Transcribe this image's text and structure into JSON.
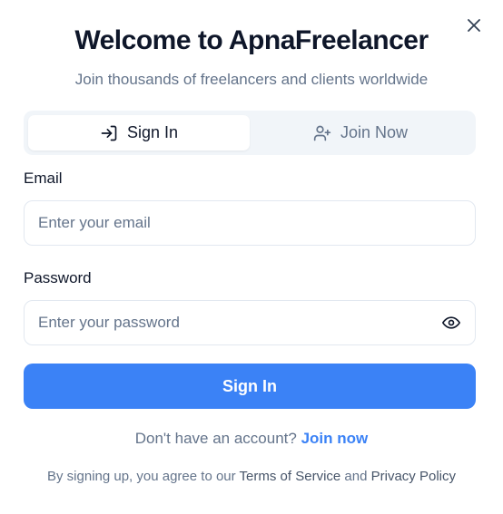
{
  "modal": {
    "title": "Welcome to ApnaFreelancer",
    "subtitle": "Join thousands of freelancers and clients worldwide",
    "close_icon": "close-icon"
  },
  "tabs": [
    {
      "label": "Sign In",
      "icon": "sign-in-icon",
      "active": true
    },
    {
      "label": "Join Now",
      "icon": "user-plus-icon",
      "active": false
    }
  ],
  "form": {
    "email": {
      "label": "Email",
      "placeholder": "Enter your email",
      "value": ""
    },
    "password": {
      "label": "Password",
      "placeholder": "Enter your password",
      "value": "",
      "toggle_icon": "eye-icon"
    },
    "submit_label": "Sign In"
  },
  "footer": {
    "prompt": "Don't have an account?",
    "link_label": "Join now",
    "legal_prefix": "By signing up, you agree to our",
    "terms_label": "Terms of Service",
    "and": "and",
    "privacy_label": "Privacy Policy"
  },
  "colors": {
    "accent": "#3b82f6",
    "title": "#0f172a",
    "muted": "#64748b",
    "tab_bg": "#f1f5f9",
    "border": "#e2e8f0"
  }
}
